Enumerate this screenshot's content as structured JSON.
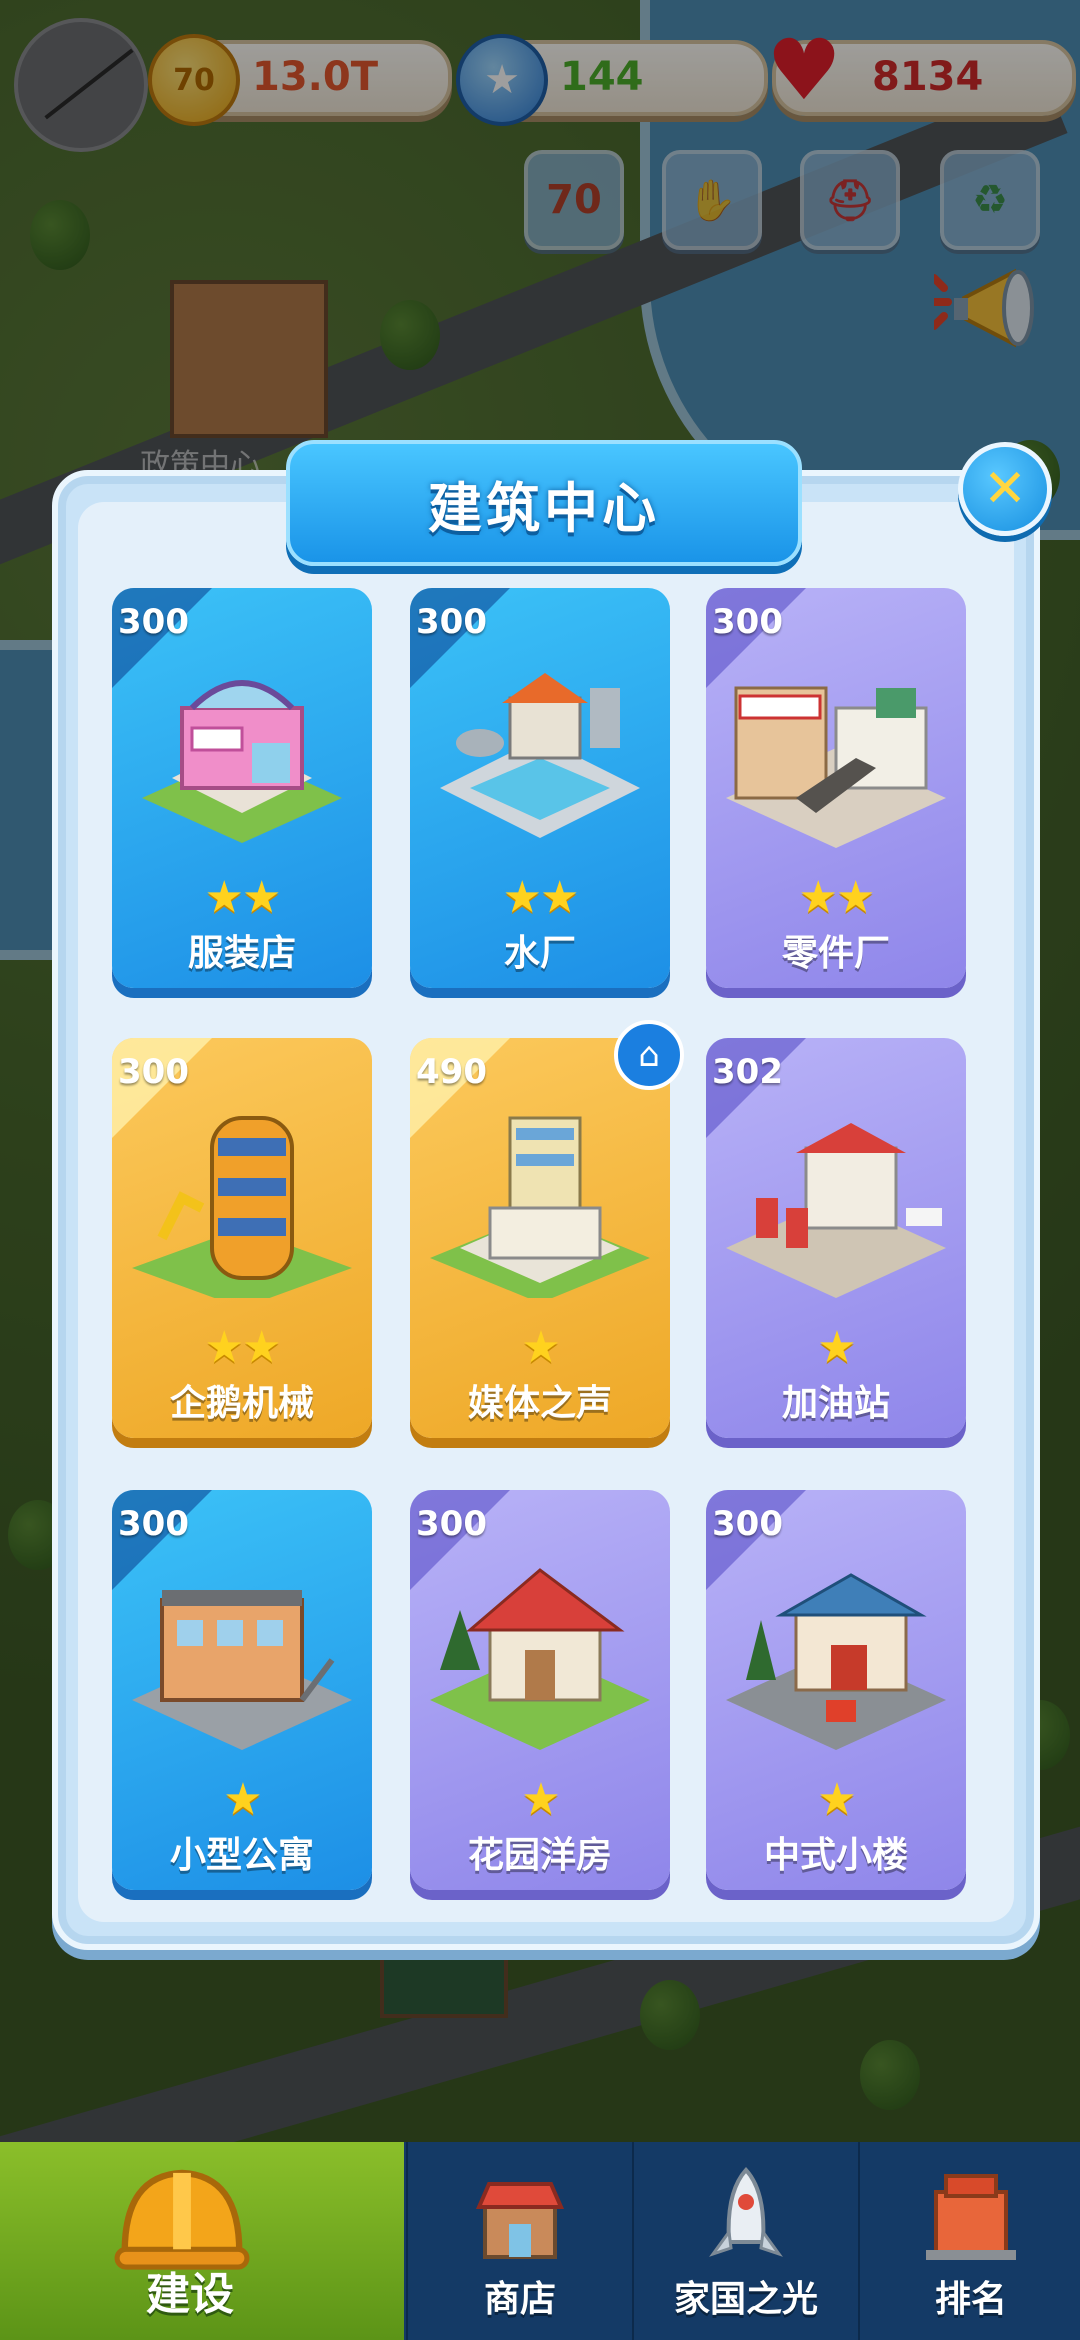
{
  "hud": {
    "coins": "13.0T",
    "gems": "144",
    "hearts": "8134",
    "coin_icon_text": "70",
    "quick_badge_text": "70"
  },
  "background": {
    "building_label": "政策中心"
  },
  "dialog": {
    "title": "建筑中心",
    "cards": [
      {
        "cost": "300",
        "name": "服装店",
        "stars": "★★",
        "theme": "blue"
      },
      {
        "cost": "300",
        "name": "水厂",
        "stars": "★★",
        "theme": "blue"
      },
      {
        "cost": "300",
        "name": "零件厂",
        "stars": "★★",
        "theme": "purple"
      },
      {
        "cost": "300",
        "name": "企鹅机械",
        "stars": "★★",
        "theme": "gold"
      },
      {
        "cost": "490",
        "name": "媒体之声",
        "stars": "★",
        "theme": "gold"
      },
      {
        "cost": "302",
        "name": "加油站",
        "stars": "★",
        "theme": "purple"
      },
      {
        "cost": "300",
        "name": "小型公寓",
        "stars": "★",
        "theme": "blue"
      },
      {
        "cost": "300",
        "name": "花园洋房",
        "stars": "★",
        "theme": "purple"
      },
      {
        "cost": "300",
        "name": "中式小楼",
        "stars": "★",
        "theme": "purple"
      }
    ]
  },
  "nav": {
    "items": [
      {
        "label": "建设",
        "active": true
      },
      {
        "label": "商店",
        "active": false
      },
      {
        "label": "家国之光",
        "active": false
      },
      {
        "label": "排名",
        "active": false
      }
    ]
  },
  "colors": {
    "card_blue": "#1d8fe6",
    "card_purple": "#8f86ea",
    "card_gold": "#eea827",
    "title_blue": "#1a94e8",
    "nav_active": "#6ea21f",
    "nav_bg": "#143a66"
  },
  "icons": {
    "close": "close-icon",
    "home_badge": "home-icon",
    "star": "star-icon"
  }
}
